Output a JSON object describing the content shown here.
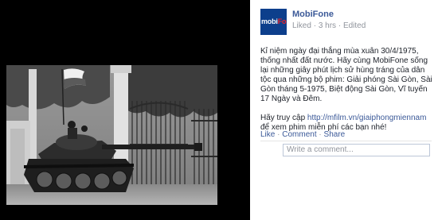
{
  "post": {
    "page_name": "MobiFone",
    "avatar_logo_left": "mobi",
    "avatar_logo_right": "Fone",
    "meta": {
      "liked": "Liked",
      "time": "3 hrs",
      "edited": "Edited",
      "separator": "·"
    },
    "caption": "Kỉ niệm ngày đại thắng mùa xuân 30/4/1975, thống nhất đất nước. Hãy cùng MobiFone sống lại những giây phút lịch sử hùng tráng của dân tộc qua những bộ phim: Giải phóng Sài Gòn, Sài Gòn tháng 5-1975, Biệt động Sài Gòn, Vĩ tuyến 17 Ngày và Đêm.",
    "link_prefix": "Hãy truy cập ",
    "link_url": "http://mfilm.vn/giaiphongmiennam",
    "link_suffix": " để xem phim miễn phí các bạn nhé!",
    "actions": {
      "like": "Like",
      "comment": "Comment",
      "share": "Share",
      "separator": "·"
    },
    "comment_placeholder": "Write a comment..."
  },
  "colors": {
    "link": "#3b5998",
    "meta": "#90949c",
    "text": "#1d2129",
    "brand": "#0d3f8c",
    "brand_accent": "#e8232a"
  }
}
